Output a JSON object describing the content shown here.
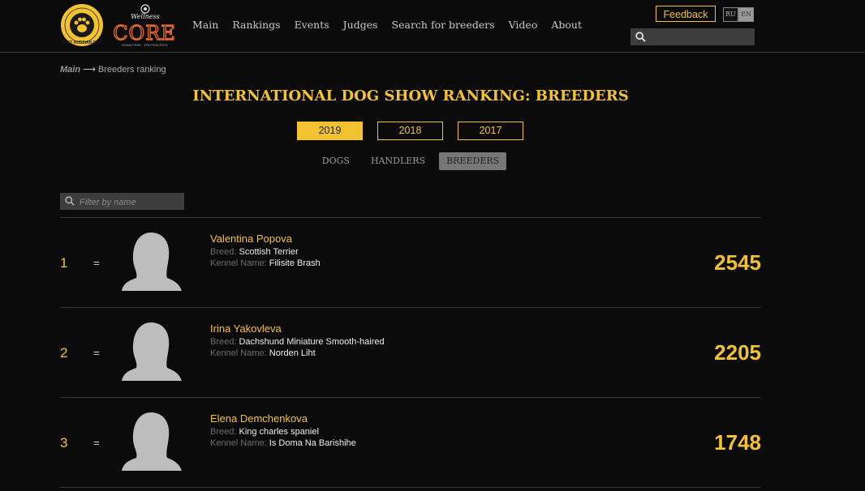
{
  "header": {
    "logo_brd_text": "BEST RUSSIAN DOG",
    "logo_core_top": "WELLNESS",
    "logo_core_main": "CORE",
    "nav": [
      "Main",
      "Rankings",
      "Events",
      "Judges",
      "Search for breeders",
      "Video",
      "About"
    ],
    "feedback_label": "Feedback",
    "lang": {
      "ru": "RU",
      "en": "EN"
    },
    "search_placeholder": ""
  },
  "breadcrumb": {
    "home": "Main",
    "arrow": "⟶",
    "current": "Breeders ranking"
  },
  "title": "INTERNATIONAL DOG SHOW RANKING: BREEDERS",
  "years": [
    {
      "label": "2019",
      "active": true
    },
    {
      "label": "2018",
      "active": false
    },
    {
      "label": "2017",
      "active": false
    }
  ],
  "tabs": [
    {
      "label": "DOGS",
      "active": false
    },
    {
      "label": "HANDLERS",
      "active": false
    },
    {
      "label": "BREEDERS",
      "active": true
    }
  ],
  "filter_placeholder": "Filter by name",
  "labels": {
    "breed": "Breed:",
    "kennel": "Kennel Name:"
  },
  "rows": [
    {
      "rank": "1",
      "change": "=",
      "name": "Valentina Popova",
      "breed": "Scottish Terrier",
      "kennel": "Filisite Brash",
      "score": "2545"
    },
    {
      "rank": "2",
      "change": "=",
      "name": "Irina Yakovleva",
      "breed": "Dachshund Miniature Smooth-haired",
      "kennel": "Norden Liht",
      "score": "2205"
    },
    {
      "rank": "3",
      "change": "=",
      "name": "Elena Demchenkova",
      "breed": "King charles spaniel",
      "kennel": "Is Doma Na Barishihe",
      "score": "1748"
    }
  ],
  "colors": {
    "accent": "#f2c230",
    "background": "#0b0b0b",
    "placeholder_avatar": "#bdbdbd"
  }
}
